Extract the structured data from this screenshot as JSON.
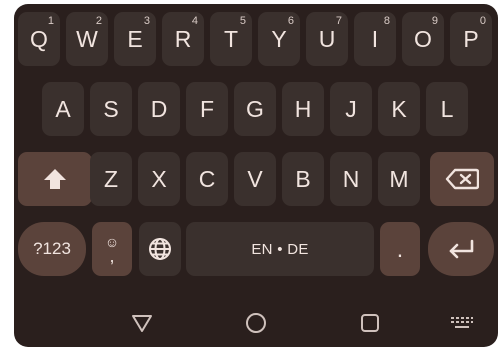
{
  "row1": [
    {
      "label": "Q",
      "hint": "1"
    },
    {
      "label": "W",
      "hint": "2"
    },
    {
      "label": "E",
      "hint": "3"
    },
    {
      "label": "R",
      "hint": "4"
    },
    {
      "label": "T",
      "hint": "5"
    },
    {
      "label": "Y",
      "hint": "6"
    },
    {
      "label": "U",
      "hint": "7"
    },
    {
      "label": "I",
      "hint": "8"
    },
    {
      "label": "O",
      "hint": "9"
    },
    {
      "label": "P",
      "hint": "0"
    }
  ],
  "row2": [
    "A",
    "S",
    "D",
    "F",
    "G",
    "H",
    "J",
    "K",
    "L"
  ],
  "row3": [
    "Z",
    "X",
    "C",
    "V",
    "B",
    "N",
    "M"
  ],
  "row4": {
    "symbols_label": "?123",
    "emoji_top": "☺",
    "emoji_bottom": ",",
    "space_label": "EN • DE",
    "period_label": "."
  },
  "icons": {
    "shift": "shift-icon",
    "backspace": "backspace-icon",
    "language": "globe-icon",
    "enter": "enter-icon",
    "nav_back": "triangle-back-icon",
    "nav_home": "circle-home-icon",
    "nav_recents": "square-recents-icon",
    "nav_keyboard": "keyboard-switch-icon"
  },
  "colors": {
    "background": "#2a1f1d",
    "key": "#3a302d",
    "function_key": "#5b433b",
    "text": "#f1e4df"
  }
}
